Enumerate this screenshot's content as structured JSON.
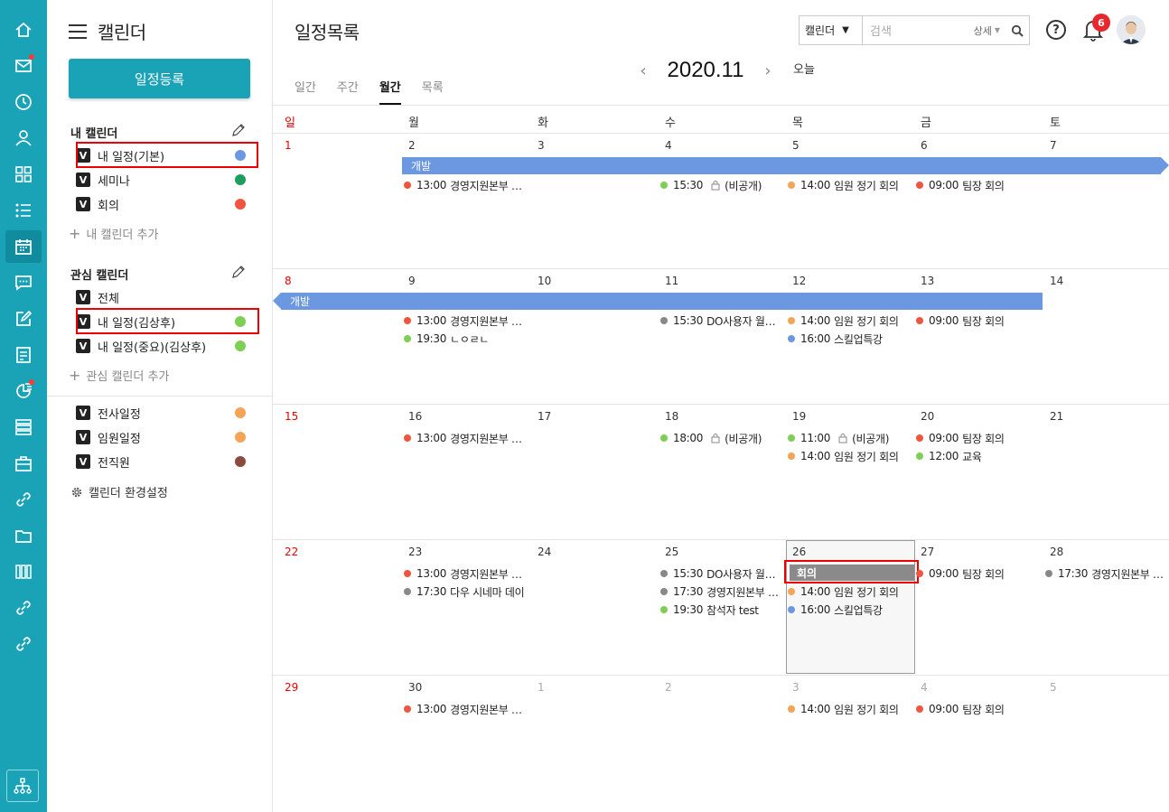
{
  "rail": {
    "icons": [
      "home-icon",
      "mail-icon",
      "clock-icon",
      "person-icon",
      "apps-icon",
      "list-icon",
      "calendar-icon",
      "chat-icon",
      "edit-icon",
      "board-icon",
      "chart-icon",
      "db-icon",
      "briefcase-icon",
      "link-icon",
      "folder-icon",
      "grid-icon",
      "link2-icon",
      "link3-icon",
      "org-chart-icon"
    ]
  },
  "sidebar": {
    "title": "캘린더",
    "register_button": "일정등록",
    "my_calendars": {
      "title": "내 캘린더",
      "items": [
        {
          "label": "내 일정(기본)",
          "color": "#6c98e2"
        },
        {
          "label": "세미나",
          "color": "#1e9e5e"
        },
        {
          "label": "회의",
          "color": "#f0553f"
        }
      ],
      "add": "내 캘린더 추가"
    },
    "watched_calendars": {
      "title": "관심 캘린더",
      "items": [
        {
          "label": "전체",
          "color": ""
        },
        {
          "label": "내 일정(김상후)",
          "color": "#7dcf55"
        },
        {
          "label": "내 일정(중요)(김상후)",
          "color": "#7dcf55"
        }
      ],
      "add": "관심 캘린더 추가"
    },
    "shared_calendars": [
      {
        "label": "전사일정",
        "color": "#f5a356"
      },
      {
        "label": "임원일정",
        "color": "#f5a356"
      },
      {
        "label": "전직원",
        "color": "#8b4a3d"
      }
    ],
    "settings": "캘린더 환경설정",
    "check_mark": "V"
  },
  "header": {
    "title": "일정목록",
    "search_scope": "캘린더",
    "search_placeholder": "검색",
    "search_detail": "상세",
    "help_label": "?",
    "notification_count": "6"
  },
  "view_tabs": [
    "일간",
    "주간",
    "월간",
    "목록"
  ],
  "active_tab": "월간",
  "month_label": "2020.11",
  "today_button": "오늘",
  "weekdays": [
    "일",
    "월",
    "화",
    "수",
    "목",
    "금",
    "토"
  ],
  "weeks": [
    {
      "days": [
        "1",
        "2",
        "3",
        "4",
        "5",
        "6",
        "7"
      ]
    },
    {
      "days": [
        "8",
        "9",
        "10",
        "11",
        "12",
        "13",
        "14"
      ]
    },
    {
      "days": [
        "15",
        "16",
        "17",
        "18",
        "19",
        "20",
        "21"
      ]
    },
    {
      "days": [
        "22",
        "23",
        "24",
        "25",
        "26",
        "27",
        "28"
      ]
    },
    {
      "days": [
        "29",
        "30",
        "1",
        "2",
        "3",
        "4",
        "5"
      ]
    }
  ],
  "events": {
    "w0_bar": "개발",
    "w1_bar": "개발",
    "w3_meeting_bar": "회의",
    "w0": [
      {
        "day": 1,
        "time": "13:00",
        "title": "경영지원본부 …",
        "color": "#f0553f"
      },
      {
        "day": 3,
        "time": "15:30",
        "title": "(비공개)",
        "color": "#7dcf55",
        "private": true
      },
      {
        "day": 4,
        "time": "14:00",
        "title": "임원 정기 회의",
        "color": "#f5a356"
      },
      {
        "day": 5,
        "time": "09:00",
        "title": "팀장 회의",
        "color": "#f0553f"
      }
    ],
    "w1": [
      {
        "day": 1,
        "row": 0,
        "time": "13:00",
        "title": "경영지원본부 …",
        "color": "#f0553f"
      },
      {
        "day": 1,
        "row": 1,
        "time": "19:30",
        "title": "ㄴㅇㄹㄴ",
        "color": "#7dcf55"
      },
      {
        "day": 3,
        "row": 0,
        "time": "15:30",
        "title": "DO사용자 월…",
        "color": "#888888"
      },
      {
        "day": 4,
        "row": 0,
        "time": "14:00",
        "title": "임원 정기 회의",
        "color": "#f5a356"
      },
      {
        "day": 4,
        "row": 1,
        "time": "16:00",
        "title": "스킬업특강",
        "color": "#6c98e2"
      },
      {
        "day": 5,
        "row": 0,
        "time": "09:00",
        "title": "팀장 회의",
        "color": "#f0553f"
      }
    ],
    "w2": [
      {
        "day": 1,
        "row": 0,
        "time": "13:00",
        "title": "경영지원본부 …",
        "color": "#f0553f"
      },
      {
        "day": 3,
        "row": 0,
        "time": "18:00",
        "title": "(비공개)",
        "color": "#7dcf55",
        "private": true
      },
      {
        "day": 4,
        "row": 0,
        "time": "11:00",
        "title": "(비공개)",
        "color": "#7dcf55",
        "private": true
      },
      {
        "day": 4,
        "row": 1,
        "time": "14:00",
        "title": "임원 정기 회의",
        "color": "#f5a356"
      },
      {
        "day": 5,
        "row": 0,
        "time": "09:00",
        "title": "팀장 회의",
        "color": "#f0553f"
      },
      {
        "day": 5,
        "row": 1,
        "time": "12:00",
        "title": "교육",
        "color": "#7dcf55"
      }
    ],
    "w3": [
      {
        "day": 1,
        "row": 0,
        "time": "13:00",
        "title": "경영지원본부 …",
        "color": "#f0553f"
      },
      {
        "day": 1,
        "row": 1,
        "time": "17:30",
        "title": "다우 시네마 데이",
        "color": "#888888"
      },
      {
        "day": 3,
        "row": 0,
        "time": "15:30",
        "title": "DO사용자 월…",
        "color": "#888888"
      },
      {
        "day": 3,
        "row": 1,
        "time": "17:30",
        "title": "경영지원본부 …",
        "color": "#888888"
      },
      {
        "day": 3,
        "row": 2,
        "time": "19:30",
        "title": "참석자 test",
        "color": "#7dcf55"
      },
      {
        "day": 4,
        "row": 1,
        "time": "14:00",
        "title": "임원 정기 회의",
        "color": "#f5a356"
      },
      {
        "day": 4,
        "row": 2,
        "time": "16:00",
        "title": "스킬업특강",
        "color": "#6c98e2"
      },
      {
        "day": 5,
        "row": 0,
        "time": "09:00",
        "title": "팀장 회의",
        "color": "#f0553f"
      },
      {
        "day": 6,
        "row": 0,
        "time": "17:30",
        "title": "경영지원본부 …",
        "color": "#888888"
      }
    ],
    "w4": [
      {
        "day": 1,
        "row": 0,
        "time": "13:00",
        "title": "경영지원본부 …",
        "color": "#f0553f"
      },
      {
        "day": 4,
        "row": 0,
        "time": "14:00",
        "title": "임원 정기 회의",
        "color": "#f5a356"
      },
      {
        "day": 5,
        "row": 0,
        "time": "09:00",
        "title": "팀장 회의",
        "color": "#f0553f"
      }
    ]
  }
}
